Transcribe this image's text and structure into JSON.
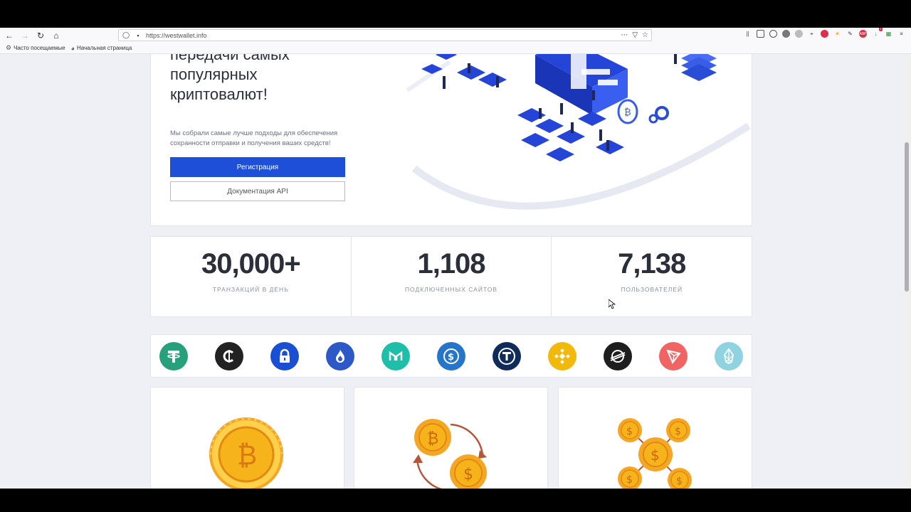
{
  "browser": {
    "url": "https://westwallet.info",
    "bookmarks": [
      {
        "label": "Часто посещаемые",
        "icon": "gear-icon"
      },
      {
        "label": "Начальная страница",
        "icon": "globe-icon"
      }
    ],
    "badge_count": "7"
  },
  "hero": {
    "title": "передачи самых популярных криптовалют!",
    "description": "Мы собрали самые лучше подходы для обеспечения сохранности отправки и получения ваших средств!",
    "register_label": "Регистрация",
    "docs_label": "Документация API"
  },
  "stats": [
    {
      "value": "30,000+",
      "label": "ТРАНЗАКЦИЙ В ДЕНЬ"
    },
    {
      "value": "1,108",
      "label": "ПОДКЛЮЧЕННЫХ САЙТОВ"
    },
    {
      "value": "7,138",
      "label": "ПОЛЬЗОВАТЕЛЕЙ"
    }
  ],
  "coins": [
    {
      "name": "tether-icon",
      "color": "#26a17b"
    },
    {
      "name": "coinex-icon",
      "color": "#222222"
    },
    {
      "name": "lock-coin-icon",
      "color": "#1b4fd3"
    },
    {
      "name": "huobi-token-icon",
      "color": "#2d58c8"
    },
    {
      "name": "maker-icon",
      "color": "#1ebfa8"
    },
    {
      "name": "usd-coin-icon",
      "color": "#2775ca"
    },
    {
      "name": "trueusd-icon",
      "color": "#0e2b5c"
    },
    {
      "name": "binance-icon",
      "color": "#f0b90b"
    },
    {
      "name": "stellar-icon",
      "color": "#1e1e1e"
    },
    {
      "name": "tron-icon",
      "color": "#f06464"
    },
    {
      "name": "eos-icon",
      "color": "#8fd3e0"
    }
  ],
  "colors": {
    "primary": "#1e4fd8",
    "gold": "#f7b41a",
    "text": "#2a2f3a"
  }
}
